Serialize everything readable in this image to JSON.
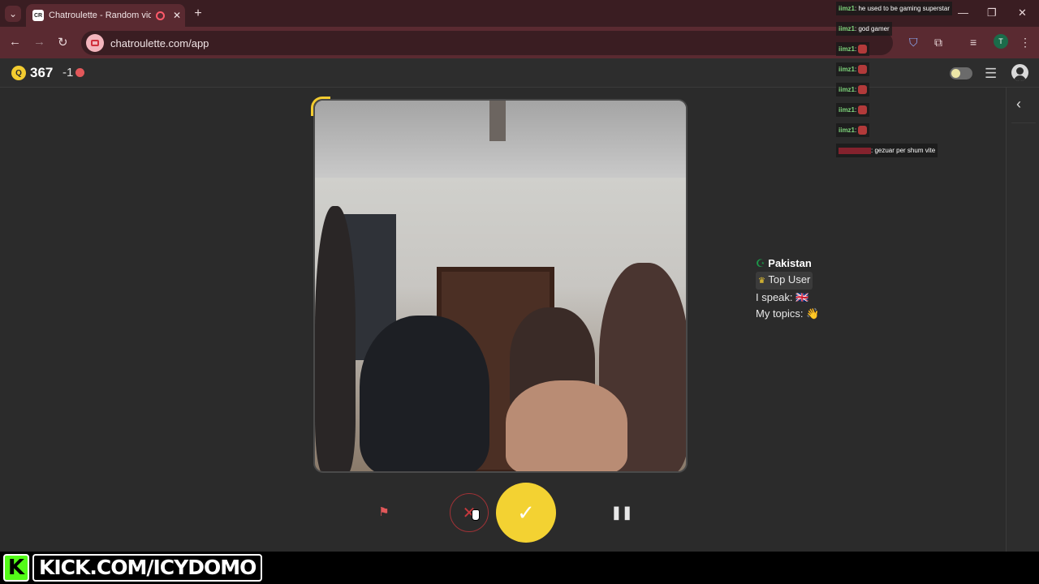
{
  "browser": {
    "tab_title": "Chatroulette - Random vide",
    "favicon_text": "CR",
    "url": "chatroulette.com/app",
    "profile_initial": "T"
  },
  "app": {
    "coin_letter": "Q",
    "coins": "367",
    "delta": "-1"
  },
  "partner": {
    "country_flag": "☪",
    "country": "Pakistan",
    "badge_icon": "♛",
    "badge": "Top User",
    "speak_label": "I speak:",
    "speak_flag": "🇬🇧",
    "topics_label": "My topics:",
    "topics_icon": "👋"
  },
  "chat": [
    {
      "user": "iimz1",
      "sep": ":",
      "text": " he used to be gaming superstar",
      "emote": false
    },
    {
      "user": "iimz1",
      "sep": ":",
      "text": " god gamer",
      "emote": false
    },
    {
      "user": "iimz1",
      "sep": ":",
      "text": " ",
      "emote": true
    },
    {
      "user": "iimz1",
      "sep": ":",
      "text": " ",
      "emote": true
    },
    {
      "user": "iimz1",
      "sep": ":",
      "text": " ",
      "emote": true
    },
    {
      "user": "iimz1",
      "sep": ":",
      "text": " ",
      "emote": true
    },
    {
      "user": "iimz1",
      "sep": ":",
      "text": " ",
      "emote": true
    },
    {
      "user": "",
      "sep": ":",
      "text": " gezuar per shum vite",
      "emote": false,
      "red": true
    }
  ],
  "overlay": {
    "kick_logo": "K",
    "kick_url": "KICK.COM/ICYDOMO"
  },
  "colors": {
    "accent": "#f3d232",
    "tab_bg": "#3a1d22",
    "skip_red": "#c6393d"
  }
}
